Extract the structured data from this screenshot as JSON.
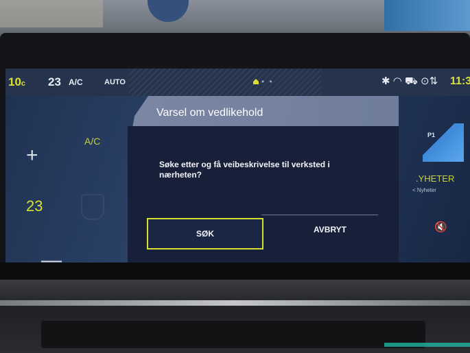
{
  "status_bar": {
    "driver_temp": "10",
    "driver_temp_unit": "c",
    "fan_temp": "23",
    "ac": "A/C",
    "auto": "AUTO",
    "dots": "• •",
    "icons_text": "✱ ◠ ⛟ ⊙⇅",
    "clock": "11:3"
  },
  "left_panel": {
    "plus": "+",
    "ac_label": "A/C",
    "seat_temp": "23",
    "minus": "—"
  },
  "dialog": {
    "title": "Varsel om vedlikehold",
    "message": "Søke etter og få veibeskrivelse til verksted i nærheten?",
    "confirm_label": "SØK",
    "cancel_label": "AVBRYT"
  },
  "right_panel": {
    "logo_text": "P1",
    "news_title": ".YHETER",
    "news_sub": "< Nyheter",
    "mute_icon": "🔇"
  }
}
